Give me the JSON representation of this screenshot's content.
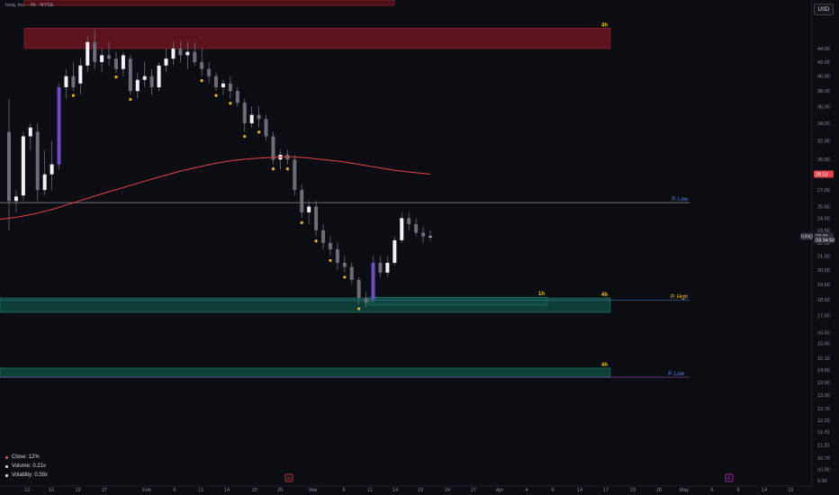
{
  "header": {
    "title": "Ionq, Inc. · 4h · NYSE",
    "currency_badge": "USD"
  },
  "chart_data": {
    "type": "candlestick",
    "symbol": "IONQ",
    "timeframe": "4h",
    "y_axis": {
      "scale": "log",
      "range": [
        9.9,
        47.7
      ],
      "tick_labels": [
        "44.00",
        "42.00",
        "40.00",
        "38.00",
        "36.00",
        "34.00",
        "32.00",
        "30.00",
        "27.00",
        "25.50",
        "24.50",
        "23.50",
        "22.50",
        "21.50",
        "20.50",
        "19.50",
        "18.50",
        "17.50",
        "16.50",
        "15.90",
        "15.10",
        "14.50",
        "13.90",
        "13.30",
        "12.70",
        "12.20",
        "11.70",
        "11.20",
        "10.70",
        "10.30",
        "9.90"
      ]
    },
    "x_axis": {
      "tick_labels": [
        "13",
        "16",
        "22",
        "27",
        "Feb",
        "6",
        "11",
        "14",
        "20",
        "25",
        "Mar",
        "6",
        "11",
        "14",
        "19",
        "24",
        "27",
        "Apr",
        "4",
        "9",
        "14",
        "17",
        "23",
        "28",
        "May",
        "6",
        "9",
        "14",
        "19"
      ]
    },
    "price_labels": [
      {
        "text": "28.52",
        "value": 28.52,
        "color": "#e0444b"
      },
      {
        "text": "23.01",
        "value": 23.01,
        "color": "#2b2d36"
      },
      {
        "text": "03:34:50",
        "value": 22.75,
        "color": "#2b2d36"
      }
    ],
    "symbol_tag": "IONQ",
    "series": [
      {
        "name": "candles",
        "ohlc": [
          [
            33,
            37,
            23.5,
            26
          ],
          [
            26,
            27,
            25,
            26.4
          ],
          [
            26.5,
            33,
            26,
            32.5
          ],
          [
            32.5,
            34,
            31,
            33.5
          ],
          [
            33,
            34,
            26,
            27
          ],
          [
            27,
            31,
            26.5,
            28.5
          ],
          [
            28.5,
            32,
            27,
            29.5
          ],
          [
            29.5,
            39,
            29,
            38.5
          ],
          [
            38.5,
            41,
            37,
            40
          ],
          [
            40,
            42,
            38,
            38.5
          ],
          [
            39,
            42.5,
            37.5,
            41.5
          ],
          [
            41.5,
            46,
            40.5,
            45
          ],
          [
            45,
            47,
            41,
            42
          ],
          [
            42,
            44,
            40.5,
            43
          ],
          [
            43,
            45,
            41.5,
            42.5
          ],
          [
            42.5,
            43.5,
            40.5,
            41
          ],
          [
            41,
            43.5,
            40,
            43
          ],
          [
            42.5,
            43,
            37.5,
            38
          ],
          [
            38,
            40.5,
            37,
            39.5
          ],
          [
            39.5,
            42,
            38.5,
            40
          ],
          [
            40,
            41,
            37.5,
            38.5
          ],
          [
            38.5,
            42,
            38,
            41.5
          ],
          [
            41.5,
            44,
            40.5,
            42.5
          ],
          [
            42.5,
            45,
            41.5,
            44
          ],
          [
            44,
            45,
            42,
            43
          ],
          [
            43,
            45,
            41,
            43.5
          ],
          [
            43.5,
            45,
            41.5,
            42
          ],
          [
            42,
            44,
            40,
            41
          ],
          [
            41,
            42,
            39,
            40
          ],
          [
            40,
            40.5,
            38,
            38.5
          ],
          [
            38.5,
            39.5,
            37.5,
            39
          ],
          [
            39,
            40,
            37,
            38
          ],
          [
            38,
            38.5,
            36,
            36.5
          ],
          [
            36.5,
            37,
            33,
            34
          ],
          [
            34,
            36,
            33.5,
            35
          ],
          [
            35,
            36,
            33.5,
            34.5
          ],
          [
            34.5,
            35,
            32,
            32.5
          ],
          [
            32.5,
            33,
            29.5,
            30
          ],
          [
            30,
            31,
            29,
            30.5
          ],
          [
            30.5,
            31,
            29.5,
            30
          ],
          [
            30,
            30.5,
            26.5,
            27
          ],
          [
            27,
            27.5,
            24.5,
            25
          ],
          [
            25,
            26,
            24,
            25.5
          ],
          [
            25.5,
            26,
            23,
            23.5
          ],
          [
            23.5,
            24,
            22,
            22.5
          ],
          [
            22.5,
            23,
            21.5,
            22
          ],
          [
            22,
            22.5,
            20.5,
            21
          ],
          [
            21,
            21.5,
            20.3,
            20.7
          ],
          [
            20.7,
            21,
            19.5,
            19.8
          ],
          [
            19.8,
            20,
            18.2,
            18.6
          ],
          [
            18.6,
            19,
            18,
            18.3
          ],
          [
            18.5,
            21.5,
            18.3,
            21
          ],
          [
            21,
            21.5,
            20,
            20.3
          ],
          [
            20.3,
            21.5,
            20,
            21
          ],
          [
            21,
            23,
            20.8,
            22.7
          ],
          [
            22.7,
            25,
            22.5,
            24.5
          ],
          [
            24.5,
            25,
            23.5,
            24
          ],
          [
            24,
            24.5,
            23,
            23.3
          ],
          [
            23.3,
            23.8,
            22.5,
            23
          ],
          [
            23,
            23.5,
            22.7,
            23.01
          ]
        ]
      },
      {
        "name": "moving-average",
        "values": [
          24.4,
          24.6,
          24.9,
          25.3,
          25.8,
          26.3,
          26.8,
          27.3,
          27.8,
          28.3,
          28.8,
          29.2,
          29.6,
          29.9,
          30.1,
          30.2,
          30.3,
          30.2,
          30.0,
          29.8,
          29.5,
          29.2,
          28.9,
          28.7,
          28.52
        ]
      }
    ],
    "zones": [
      {
        "tag": "4h",
        "low": 44.0,
        "high": 47.2,
        "color": "#6b1520"
      },
      {
        "tag": "4h",
        "low": 17.7,
        "high": 18.6,
        "color": "#0f4a40"
      },
      {
        "tag": "1h",
        "low": 18.15,
        "high": 18.65,
        "color": "#0f4a40"
      },
      {
        "tag": "4h",
        "low": 14.15,
        "high": 14.6,
        "color": "#0f4a40"
      }
    ],
    "levels": [
      {
        "label": "P. Low",
        "value": 25.85
      },
      {
        "label": "P. High",
        "value": 18.45
      },
      {
        "label": "P. Low",
        "value": 14.15
      }
    ],
    "event_markers": [
      {
        "glyph": "⊞",
        "color": "#e0444b"
      },
      {
        "glyph": "E",
        "color": "#c22fd0"
      }
    ],
    "colors": {
      "background": "#0c0d12",
      "up_candle": "#f2f3f5",
      "down_candle": "#6b6e78",
      "highlight_candle": "#6d4bc9",
      "ma_line": "#e0444b",
      "dot": "#f0b429",
      "zone_bear": "#6b1520",
      "zone_bull": "#0f4a40",
      "level_line": "#9aa0ad",
      "label_blue": "#4a8cf0",
      "label_gold": "#f0c419"
    },
    "grid": false
  },
  "legend": [
    {
      "label": "Close: 12%",
      "color": "#e05a5a"
    },
    {
      "label": "Volume: 0.21x",
      "color": "#e9ecf2"
    },
    {
      "label": "Volatility: 0.59x",
      "color": "#e9ecf2"
    }
  ]
}
